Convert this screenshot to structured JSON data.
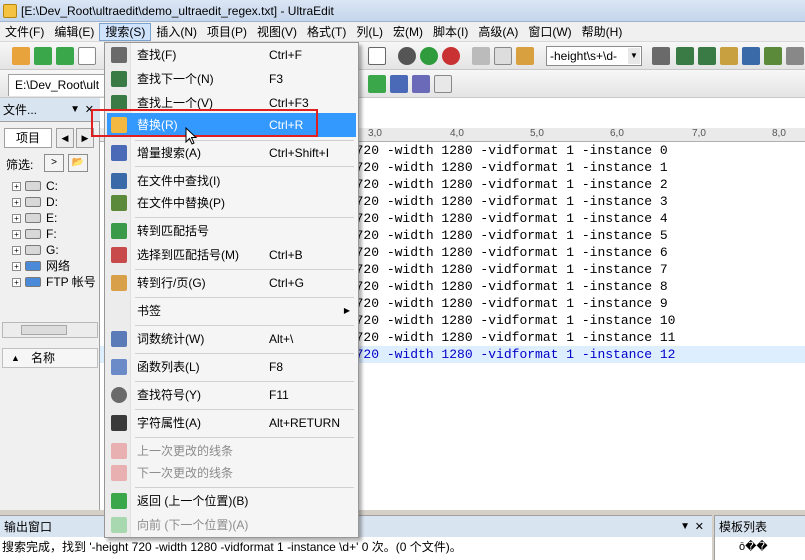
{
  "window": {
    "title": "[E:\\Dev_Root\\ultraedit\\demo_ultraedit_regex.txt] - UltraEdit"
  },
  "menubar": {
    "items": [
      {
        "label": "文件(F)"
      },
      {
        "label": "编辑(E)"
      },
      {
        "label": "搜索(S)"
      },
      {
        "label": "插入(N)"
      },
      {
        "label": "项目(P)"
      },
      {
        "label": "视图(V)"
      },
      {
        "label": "格式(T)"
      },
      {
        "label": "列(L)"
      },
      {
        "label": "宏(M)"
      },
      {
        "label": "脚本(I)"
      },
      {
        "label": "高级(A)"
      },
      {
        "label": "窗口(W)"
      },
      {
        "label": "帮助(H)"
      }
    ]
  },
  "toolbar": {
    "search_value": "-height\\s+\\d-"
  },
  "file_tab": {
    "label": "E:\\Dev_Root\\ult"
  },
  "left_panel": {
    "title": "文件...",
    "tab_label": "项目",
    "filter_label": "筛选:",
    "tree": [
      {
        "label": "C:"
      },
      {
        "label": "D:"
      },
      {
        "label": "E:"
      },
      {
        "label": "F:"
      },
      {
        "label": "G:"
      },
      {
        "label": "网络"
      },
      {
        "label": "FTP 帐号"
      }
    ],
    "name_column": "名称"
  },
  "ruler": {
    "marks": [
      "3,0",
      "4,0",
      "5,0",
      "6,0",
      "7,0",
      "8,0"
    ]
  },
  "editor": {
    "lines": [
      "e 5 -height 720 -width 1280 -vidformat 1 -instance 0",
      "e 5 -height 720 -width 1280 -vidformat 1 -instance 1",
      "e 5 -height 720 -width 1280 -vidformat 1 -instance 2",
      "e 5 -height 720 -width 1280 -vidformat 1 -instance 3",
      "e 5 -height 720 -width 1280 -vidformat 1 -instance 4",
      "e 5 -height 720 -width 1280 -vidformat 1 -instance 5",
      "e 5 -height 720 -width 1280 -vidformat 1 -instance 6",
      "e 5 -height 720 -width 1280 -vidformat 1 -instance 7",
      "e 5 -height 720 -width 1280 -vidformat 1 -instance 8",
      "e 5 -height 720 -width 1280 -vidformat 1 -instance 9",
      "e 5 -height 720 -width 1280 -vidformat 1 -instance 10",
      "e 5 -height 720 -width 1280 -vidformat 1 -instance 11",
      "e 5 -height 720 -width 1280 -vidformat 1 -instance 12"
    ]
  },
  "search_menu": {
    "items": [
      {
        "label": "查找(F)",
        "shortcut": "Ctrl+F",
        "icon": "binoculars-icon"
      },
      {
        "label": "查找下一个(N)",
        "shortcut": "F3",
        "icon": "find-next-icon"
      },
      {
        "label": "查找上一个(V)",
        "shortcut": "Ctrl+F3",
        "icon": "find-prev-icon"
      },
      {
        "label": "替换(R)",
        "shortcut": "Ctrl+R",
        "icon": "replace-icon"
      },
      {
        "label": "增量搜索(A)",
        "shortcut": "Ctrl+Shift+I",
        "icon": "incremental-search-icon"
      },
      {
        "label": "在文件中查找(I)",
        "shortcut": "",
        "icon": "find-in-files-icon"
      },
      {
        "label": "在文件中替换(P)",
        "shortcut": "",
        "icon": "replace-in-files-icon"
      },
      {
        "label": "转到匹配括号",
        "shortcut": "",
        "icon": "goto-brace-icon"
      },
      {
        "label": "选择到匹配括号(M)",
        "shortcut": "Ctrl+B",
        "icon": "select-brace-icon"
      },
      {
        "label": "转到行/页(G)",
        "shortcut": "Ctrl+G",
        "icon": "goto-line-icon"
      },
      {
        "label": "书签",
        "shortcut": "",
        "icon": ""
      },
      {
        "label": "词数统计(W)",
        "shortcut": "Alt+\\",
        "icon": "word-count-icon"
      },
      {
        "label": "函数列表(L)",
        "shortcut": "F8",
        "icon": "function-list-icon"
      },
      {
        "label": "查找符号(Y)",
        "shortcut": "F11",
        "icon": "find-symbol-icon"
      },
      {
        "label": "字符属性(A)",
        "shortcut": "Alt+RETURN",
        "icon": "char-props-icon"
      },
      {
        "label": "上一次更改的线条",
        "shortcut": "",
        "icon": "prev-change-icon"
      },
      {
        "label": "下一次更改的线条",
        "shortcut": "",
        "icon": "next-change-icon"
      },
      {
        "label": "返回 (上一个位置)(B)",
        "shortcut": "",
        "icon": "back-icon"
      },
      {
        "label": "向前 (下一个位置)(A)",
        "shortcut": "",
        "icon": "forward-icon"
      }
    ]
  },
  "output": {
    "title": "输出窗口",
    "message": "搜索完成，找到 '-height 720 -width 1280 -vidformat 1 -instance \\d+' 0 次。(0 个文件)。"
  },
  "template_panel": {
    "title": "模板列表",
    "item": "ō��"
  }
}
